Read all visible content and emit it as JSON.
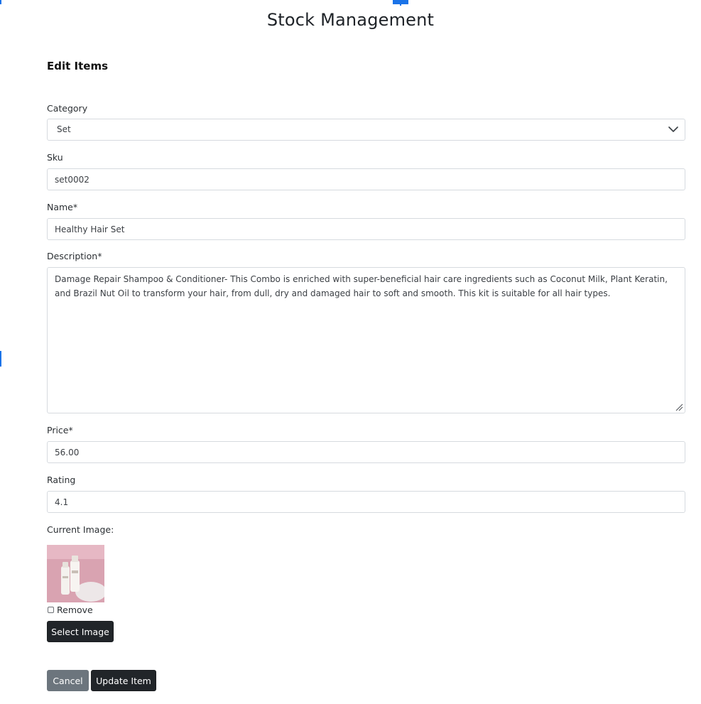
{
  "page": {
    "title": "Stock Management"
  },
  "form": {
    "heading": "Edit Items",
    "category": {
      "label": "Category",
      "value": "Set"
    },
    "sku": {
      "label": "Sku",
      "value": "set0002"
    },
    "name": {
      "label": "Name*",
      "value": "Healthy Hair Set"
    },
    "description": {
      "label": "Description*",
      "value": "Damage Repair Shampoo & Conditioner- This  Combo is enriched with super-beneficial hair care ingredients such as Coconut Milk, Plant Keratin, and Brazil Nut Oil to transform your hair, from dull, dry and damaged hair to soft and smooth. This kit is suitable for all hair types."
    },
    "price": {
      "label": "Price*",
      "value": "56.00"
    },
    "rating": {
      "label": "Rating",
      "value": "4.1"
    },
    "current_image": {
      "label": "Current Image:",
      "remove_label": "Remove",
      "remove_checked": false
    },
    "buttons": {
      "select_image": "Select Image",
      "cancel": "Cancel",
      "update": "Update Item"
    }
  },
  "icons": {
    "category_dropdown": "chevron-down-icon",
    "textarea_resize": "resize-grip-icon",
    "thumbnail": "product-image"
  },
  "colors": {
    "dark_button": "#212529",
    "secondary_button": "#6c757d",
    "field_border": "#d6dadf",
    "thumb_background": "#d9a3b1"
  }
}
